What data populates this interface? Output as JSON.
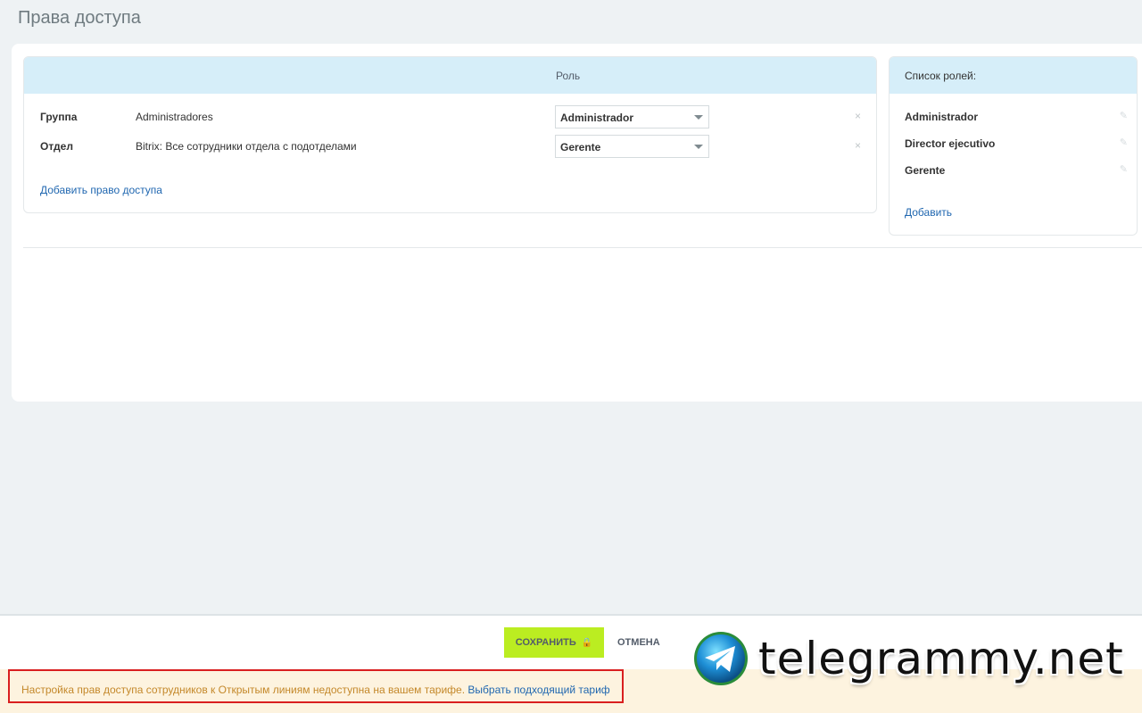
{
  "page": {
    "title": "Права доступа"
  },
  "rights_table": {
    "role_column": "Роль",
    "rows": [
      {
        "type": "Группа",
        "name": "Administradores",
        "role": "Administrador"
      },
      {
        "type": "Отдел",
        "name": "Bitrix: Все сотрудники отдела с подотделами",
        "role": "Gerente"
      }
    ],
    "remove_glyph": "×",
    "add_link": "Добавить право доступа"
  },
  "roles_panel": {
    "title": "Список ролей:",
    "roles": [
      "Administrador",
      "Director ejecutivo",
      "Gerente"
    ],
    "add_link": "Добавить"
  },
  "footer": {
    "save_label": "СОХРАНИТЬ",
    "cancel_label": "ОТМЕНА",
    "notice_text": "Настройка прав доступа сотрудников к Открытым линиям недоступна на вашем тарифе.",
    "notice_link": "Выбрать подходящий тариф"
  },
  "watermark": {
    "text": "telegrammy.net"
  },
  "colors": {
    "header_bg": "#d6eef9",
    "save_button": "#bbed21",
    "link": "#2067b0",
    "notice_bg": "#fdf3df",
    "notice_text": "#c4882a",
    "highlight_border": "#d91f1f"
  }
}
